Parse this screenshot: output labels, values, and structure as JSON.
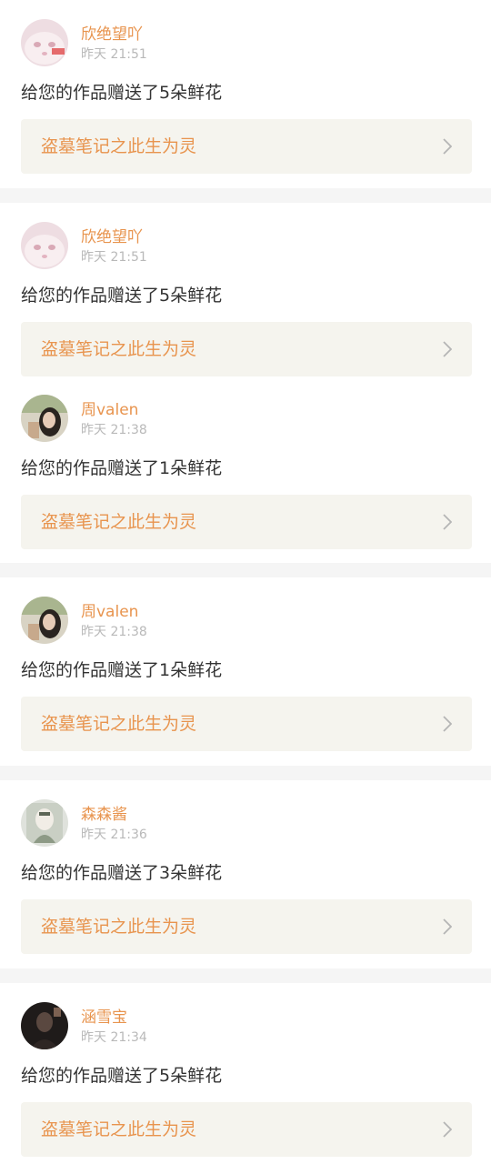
{
  "notifications": [
    {
      "username": "欣绝望吖",
      "time": "昨天 21:51",
      "message": "给您的作品赠送了5朵鲜花",
      "work_title": "盗墓笔记之此生为灵",
      "avatar": "cat-photo-avatar"
    },
    {
      "username": "欣绝望吖",
      "time": "昨天 21:51",
      "message": "给您的作品赠送了5朵鲜花",
      "work_title": "盗墓笔记之此生为灵",
      "avatar": "cat-photo-avatar"
    },
    {
      "username": "周valen",
      "time": "昨天 21:38",
      "message": "给您的作品赠送了1朵鲜花",
      "work_title": "盗墓笔记之此生为灵",
      "avatar": "girl-photo-avatar"
    },
    {
      "username": "周valen",
      "time": "昨天 21:38",
      "message": "给您的作品赠送了1朵鲜花",
      "work_title": "盗墓笔记之此生为灵",
      "avatar": "girl-photo-avatar"
    },
    {
      "username": "森森酱",
      "time": "昨天 21:36",
      "message": "给您的作品赠送了3朵鲜花",
      "work_title": "盗墓笔记之此生为灵",
      "avatar": "illustration-avatar"
    },
    {
      "username": "涵雪宝",
      "time": "昨天 21:34",
      "message": "给您的作品赠送了5朵鲜花",
      "work_title": "盗墓笔记之此生为灵",
      "avatar": "dark-photo-avatar"
    }
  ],
  "colors": {
    "accent": "#e8944e",
    "link_bg": "#f5f4ee",
    "separator": "#f5f5f5",
    "timestamp": "#b9b9b9",
    "message": "#333333"
  }
}
